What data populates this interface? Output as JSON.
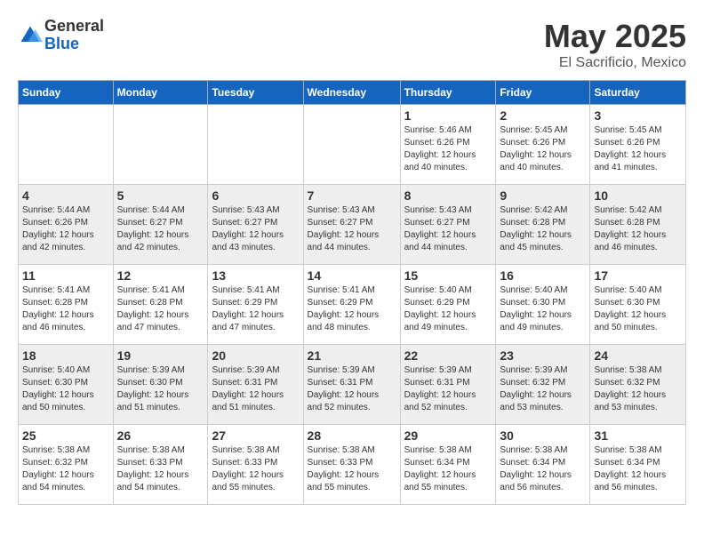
{
  "header": {
    "logo_general": "General",
    "logo_blue": "Blue",
    "title": "May 2025",
    "subtitle": "El Sacrificio, Mexico"
  },
  "weekdays": [
    "Sunday",
    "Monday",
    "Tuesday",
    "Wednesday",
    "Thursday",
    "Friday",
    "Saturday"
  ],
  "weeks": [
    [
      {
        "day": "",
        "info": ""
      },
      {
        "day": "",
        "info": ""
      },
      {
        "day": "",
        "info": ""
      },
      {
        "day": "",
        "info": ""
      },
      {
        "day": "1",
        "info": "Sunrise: 5:46 AM\nSunset: 6:26 PM\nDaylight: 12 hours\nand 40 minutes."
      },
      {
        "day": "2",
        "info": "Sunrise: 5:45 AM\nSunset: 6:26 PM\nDaylight: 12 hours\nand 40 minutes."
      },
      {
        "day": "3",
        "info": "Sunrise: 5:45 AM\nSunset: 6:26 PM\nDaylight: 12 hours\nand 41 minutes."
      }
    ],
    [
      {
        "day": "4",
        "info": "Sunrise: 5:44 AM\nSunset: 6:26 PM\nDaylight: 12 hours\nand 42 minutes."
      },
      {
        "day": "5",
        "info": "Sunrise: 5:44 AM\nSunset: 6:27 PM\nDaylight: 12 hours\nand 42 minutes."
      },
      {
        "day": "6",
        "info": "Sunrise: 5:43 AM\nSunset: 6:27 PM\nDaylight: 12 hours\nand 43 minutes."
      },
      {
        "day": "7",
        "info": "Sunrise: 5:43 AM\nSunset: 6:27 PM\nDaylight: 12 hours\nand 44 minutes."
      },
      {
        "day": "8",
        "info": "Sunrise: 5:43 AM\nSunset: 6:27 PM\nDaylight: 12 hours\nand 44 minutes."
      },
      {
        "day": "9",
        "info": "Sunrise: 5:42 AM\nSunset: 6:28 PM\nDaylight: 12 hours\nand 45 minutes."
      },
      {
        "day": "10",
        "info": "Sunrise: 5:42 AM\nSunset: 6:28 PM\nDaylight: 12 hours\nand 46 minutes."
      }
    ],
    [
      {
        "day": "11",
        "info": "Sunrise: 5:41 AM\nSunset: 6:28 PM\nDaylight: 12 hours\nand 46 minutes."
      },
      {
        "day": "12",
        "info": "Sunrise: 5:41 AM\nSunset: 6:28 PM\nDaylight: 12 hours\nand 47 minutes."
      },
      {
        "day": "13",
        "info": "Sunrise: 5:41 AM\nSunset: 6:29 PM\nDaylight: 12 hours\nand 47 minutes."
      },
      {
        "day": "14",
        "info": "Sunrise: 5:41 AM\nSunset: 6:29 PM\nDaylight: 12 hours\nand 48 minutes."
      },
      {
        "day": "15",
        "info": "Sunrise: 5:40 AM\nSunset: 6:29 PM\nDaylight: 12 hours\nand 49 minutes."
      },
      {
        "day": "16",
        "info": "Sunrise: 5:40 AM\nSunset: 6:30 PM\nDaylight: 12 hours\nand 49 minutes."
      },
      {
        "day": "17",
        "info": "Sunrise: 5:40 AM\nSunset: 6:30 PM\nDaylight: 12 hours\nand 50 minutes."
      }
    ],
    [
      {
        "day": "18",
        "info": "Sunrise: 5:40 AM\nSunset: 6:30 PM\nDaylight: 12 hours\nand 50 minutes."
      },
      {
        "day": "19",
        "info": "Sunrise: 5:39 AM\nSunset: 6:30 PM\nDaylight: 12 hours\nand 51 minutes."
      },
      {
        "day": "20",
        "info": "Sunrise: 5:39 AM\nSunset: 6:31 PM\nDaylight: 12 hours\nand 51 minutes."
      },
      {
        "day": "21",
        "info": "Sunrise: 5:39 AM\nSunset: 6:31 PM\nDaylight: 12 hours\nand 52 minutes."
      },
      {
        "day": "22",
        "info": "Sunrise: 5:39 AM\nSunset: 6:31 PM\nDaylight: 12 hours\nand 52 minutes."
      },
      {
        "day": "23",
        "info": "Sunrise: 5:39 AM\nSunset: 6:32 PM\nDaylight: 12 hours\nand 53 minutes."
      },
      {
        "day": "24",
        "info": "Sunrise: 5:38 AM\nSunset: 6:32 PM\nDaylight: 12 hours\nand 53 minutes."
      }
    ],
    [
      {
        "day": "25",
        "info": "Sunrise: 5:38 AM\nSunset: 6:32 PM\nDaylight: 12 hours\nand 54 minutes."
      },
      {
        "day": "26",
        "info": "Sunrise: 5:38 AM\nSunset: 6:33 PM\nDaylight: 12 hours\nand 54 minutes."
      },
      {
        "day": "27",
        "info": "Sunrise: 5:38 AM\nSunset: 6:33 PM\nDaylight: 12 hours\nand 55 minutes."
      },
      {
        "day": "28",
        "info": "Sunrise: 5:38 AM\nSunset: 6:33 PM\nDaylight: 12 hours\nand 55 minutes."
      },
      {
        "day": "29",
        "info": "Sunrise: 5:38 AM\nSunset: 6:34 PM\nDaylight: 12 hours\nand 55 minutes."
      },
      {
        "day": "30",
        "info": "Sunrise: 5:38 AM\nSunset: 6:34 PM\nDaylight: 12 hours\nand 56 minutes."
      },
      {
        "day": "31",
        "info": "Sunrise: 5:38 AM\nSunset: 6:34 PM\nDaylight: 12 hours\nand 56 minutes."
      }
    ]
  ]
}
